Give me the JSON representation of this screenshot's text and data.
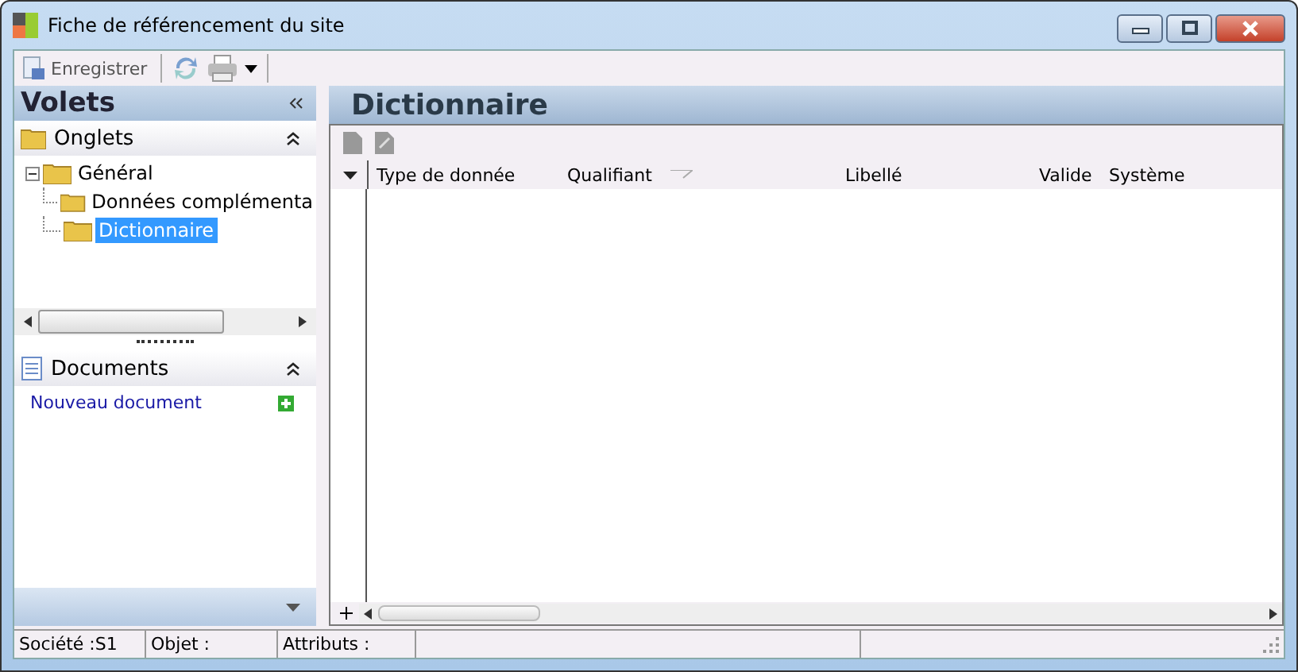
{
  "window": {
    "title": "Fiche de référencement du site"
  },
  "toolbar": {
    "save_label": "Enregistrer"
  },
  "left_panel": {
    "title": "Volets",
    "sections": [
      {
        "title": "Onglets",
        "expanded": true
      },
      {
        "title": "Documents",
        "expanded": true
      }
    ],
    "tree": [
      {
        "label": "Général",
        "expanded": true,
        "selected": false,
        "children": [
          {
            "label": "Données complémenta",
            "selected": false
          },
          {
            "label": "Dictionnaire",
            "selected": true
          }
        ]
      }
    ],
    "documents_link": "Nouveau document"
  },
  "main": {
    "title": "Dictionnaire",
    "table": {
      "columns": [
        "Type de donnée",
        "Qualifiant",
        "Libellé",
        "Valide",
        "Système"
      ]
    }
  },
  "status_bar": [
    "Société :S1",
    "Objet :",
    "Attributs :"
  ]
}
